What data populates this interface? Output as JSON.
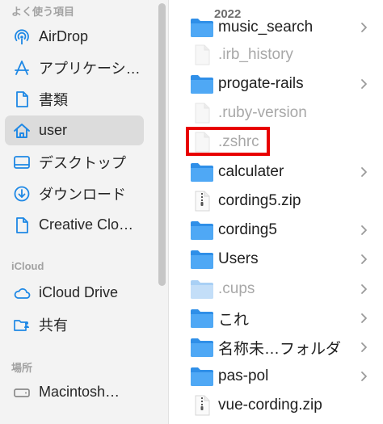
{
  "sidebar": {
    "favorites_header": "よく使う項目",
    "favorites": [
      {
        "label": "AirDrop",
        "icon": "airdrop-icon"
      },
      {
        "label": "アプリケーシ…",
        "icon": "applications-icon"
      },
      {
        "label": "書類",
        "icon": "document-icon"
      },
      {
        "label": "user",
        "icon": "home-icon",
        "selected": true
      },
      {
        "label": "デスクトップ",
        "icon": "desktop-icon"
      },
      {
        "label": "ダウンロード",
        "icon": "download-icon"
      },
      {
        "label": "Creative Clo…",
        "icon": "file-icon"
      }
    ],
    "icloud_header": "iCloud",
    "icloud": [
      {
        "label": "iCloud Drive",
        "icon": "cloud-icon"
      },
      {
        "label": "共有",
        "icon": "shared-folder-icon"
      }
    ],
    "locations_header": "場所",
    "locations": [
      {
        "label": "Macintosh…",
        "icon": "disk-icon"
      }
    ]
  },
  "column": {
    "header": "2022",
    "items": [
      {
        "name": "music_search",
        "type": "folder",
        "dim": false,
        "chevron": true
      },
      {
        "name": ".irb_history",
        "type": "file",
        "dim": true,
        "chevron": false
      },
      {
        "name": "progate-rails",
        "type": "folder",
        "dim": false,
        "chevron": true
      },
      {
        "name": ".ruby-version",
        "type": "file",
        "dim": true,
        "chevron": false
      },
      {
        "name": ".zshrc",
        "type": "file",
        "dim": true,
        "chevron": false
      },
      {
        "name": "calculater",
        "type": "folder",
        "dim": false,
        "chevron": true
      },
      {
        "name": "cording5.zip",
        "type": "zip",
        "dim": false,
        "chevron": false
      },
      {
        "name": "cording5",
        "type": "folder",
        "dim": false,
        "chevron": true
      },
      {
        "name": "Users",
        "type": "folder",
        "dim": false,
        "chevron": true
      },
      {
        "name": ".cups",
        "type": "folder-dim",
        "dim": true,
        "chevron": true
      },
      {
        "name": "これ",
        "type": "folder",
        "dim": false,
        "chevron": true
      },
      {
        "name": "名称未…フォルダ",
        "type": "folder",
        "dim": false,
        "chevron": true
      },
      {
        "name": "pas-pol",
        "type": "folder",
        "dim": false,
        "chevron": true
      },
      {
        "name": "vue-cording.zip",
        "type": "zip",
        "dim": false,
        "chevron": false
      }
    ]
  },
  "colors": {
    "accent": "#1e88e5",
    "folder": "#3b9ef3",
    "highlight": "#e80000"
  }
}
